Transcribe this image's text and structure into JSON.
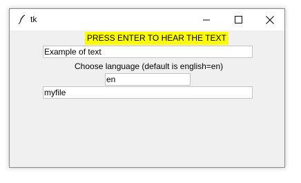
{
  "window": {
    "title": "tk",
    "icon": "feather-icon",
    "controls": [
      "minimize-icon",
      "maximize-icon",
      "close-icon"
    ]
  },
  "form": {
    "instruction_label": "PRESS ENTER TO HEAR THE TEXT",
    "instruction_bg": "#ffff00",
    "text_entry_value": "Example of text",
    "language_label": "Choose language (default is english=en)",
    "language_entry_value": "en",
    "filename_entry_value": "myfile"
  }
}
